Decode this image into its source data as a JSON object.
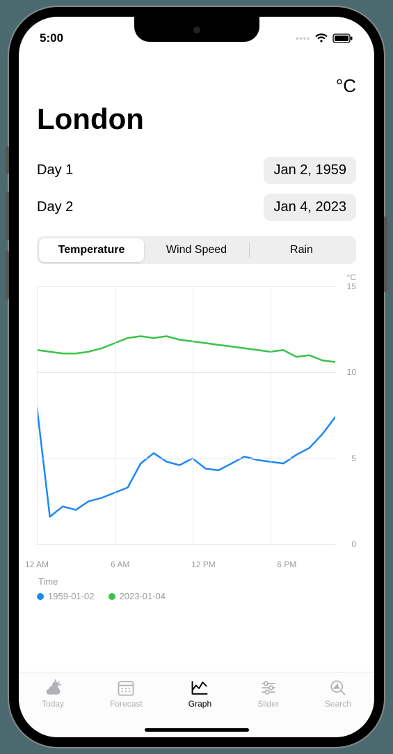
{
  "status": {
    "time": "5:00"
  },
  "unit_label": "°C",
  "page_title": "London",
  "day_rows": [
    {
      "label": "Day 1",
      "value": "Jan 2, 1959"
    },
    {
      "label": "Day 2",
      "value": "Jan 4, 2023"
    }
  ],
  "segments": {
    "temperature": "Temperature",
    "wind_speed": "Wind Speed",
    "rain": "Rain",
    "active": "temperature"
  },
  "chart_meta": {
    "y_unit": "°C",
    "x_title": "Time",
    "x_ticks": [
      "12 AM",
      "6 AM",
      "12 PM",
      "6 PM"
    ],
    "y_ticks": [
      "15",
      "10",
      "5",
      "0"
    ],
    "legend": [
      {
        "label": "1959-01-02",
        "color": "#1e88f5"
      },
      {
        "label": "2023-01-04",
        "color": "#3cc24a"
      }
    ]
  },
  "tabs": {
    "today": "Today",
    "forecast": "Forecast",
    "graph": "Graph",
    "slider": "Slider",
    "search": "Search",
    "active": "graph"
  },
  "chart_data": {
    "type": "line",
    "title": "",
    "xlabel": "Time",
    "ylabel": "°C",
    "ylim": [
      0,
      15
    ],
    "categories_hours": [
      0,
      1,
      2,
      3,
      4,
      5,
      6,
      7,
      8,
      9,
      10,
      11,
      12,
      13,
      14,
      15,
      16,
      17,
      18,
      19,
      20,
      21,
      22,
      23
    ],
    "x_tick_labels": [
      "12 AM",
      "6 AM",
      "12 PM",
      "6 PM"
    ],
    "series": [
      {
        "name": "1959-01-02",
        "color": "#1e88f5",
        "values": [
          8.0,
          1.6,
          2.2,
          2.0,
          2.5,
          2.7,
          3.0,
          3.3,
          4.7,
          5.3,
          4.8,
          4.6,
          5.0,
          4.4,
          4.3,
          4.7,
          5.1,
          4.9,
          4.8,
          4.7,
          5.2,
          5.6,
          6.4,
          7.4
        ]
      },
      {
        "name": "2023-01-04",
        "color": "#3cc24a",
        "values": [
          11.3,
          11.2,
          11.1,
          11.1,
          11.2,
          11.4,
          11.7,
          12.0,
          12.1,
          12.0,
          12.1,
          11.9,
          11.8,
          11.7,
          11.6,
          11.5,
          11.4,
          11.3,
          11.2,
          11.3,
          10.9,
          11.0,
          10.7,
          10.6
        ]
      }
    ]
  }
}
